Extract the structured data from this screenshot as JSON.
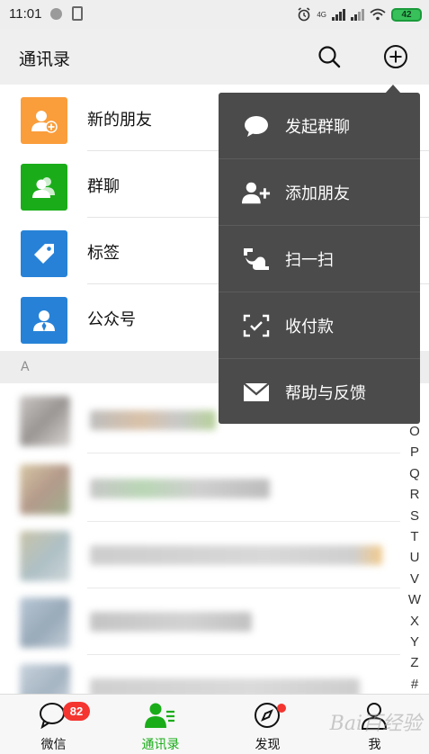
{
  "status_bar": {
    "time": "11:01",
    "battery": "42",
    "network": "4G"
  },
  "header": {
    "title": "通讯录"
  },
  "menu": {
    "items": [
      {
        "label": "发起群聊",
        "icon": "chat-bubble-icon"
      },
      {
        "label": "添加朋友",
        "icon": "add-friend-icon"
      },
      {
        "label": "扫一扫",
        "icon": "scan-icon"
      },
      {
        "label": "收付款",
        "icon": "payment-icon"
      },
      {
        "label": "帮助与反馈",
        "icon": "mail-icon"
      }
    ]
  },
  "contacts_top": [
    {
      "label": "新的朋友",
      "icon": "new-friend-icon",
      "color": "#fa9d3b"
    },
    {
      "label": "群聊",
      "icon": "group-chat-icon",
      "color": "#1aad19"
    },
    {
      "label": "标签",
      "icon": "tag-icon",
      "color": "#2782d7"
    },
    {
      "label": "公众号",
      "icon": "official-account-icon",
      "color": "#2782d7"
    }
  ],
  "section_letter": "A",
  "index_letters": [
    "O",
    "P",
    "Q",
    "R",
    "S",
    "T",
    "U",
    "V",
    "W",
    "X",
    "Y",
    "Z",
    "#"
  ],
  "tabs": [
    {
      "label": "微信",
      "icon": "chat-icon",
      "badge": "82"
    },
    {
      "label": "通讯录",
      "icon": "contacts-icon",
      "active": true
    },
    {
      "label": "发现",
      "icon": "compass-icon"
    },
    {
      "label": "我",
      "icon": "profile-icon"
    }
  ],
  "watermark": "Bai百经验",
  "colors": {
    "accent": "#1aad19",
    "menu_bg": "#4b4b4b",
    "badge": "#f43530"
  }
}
